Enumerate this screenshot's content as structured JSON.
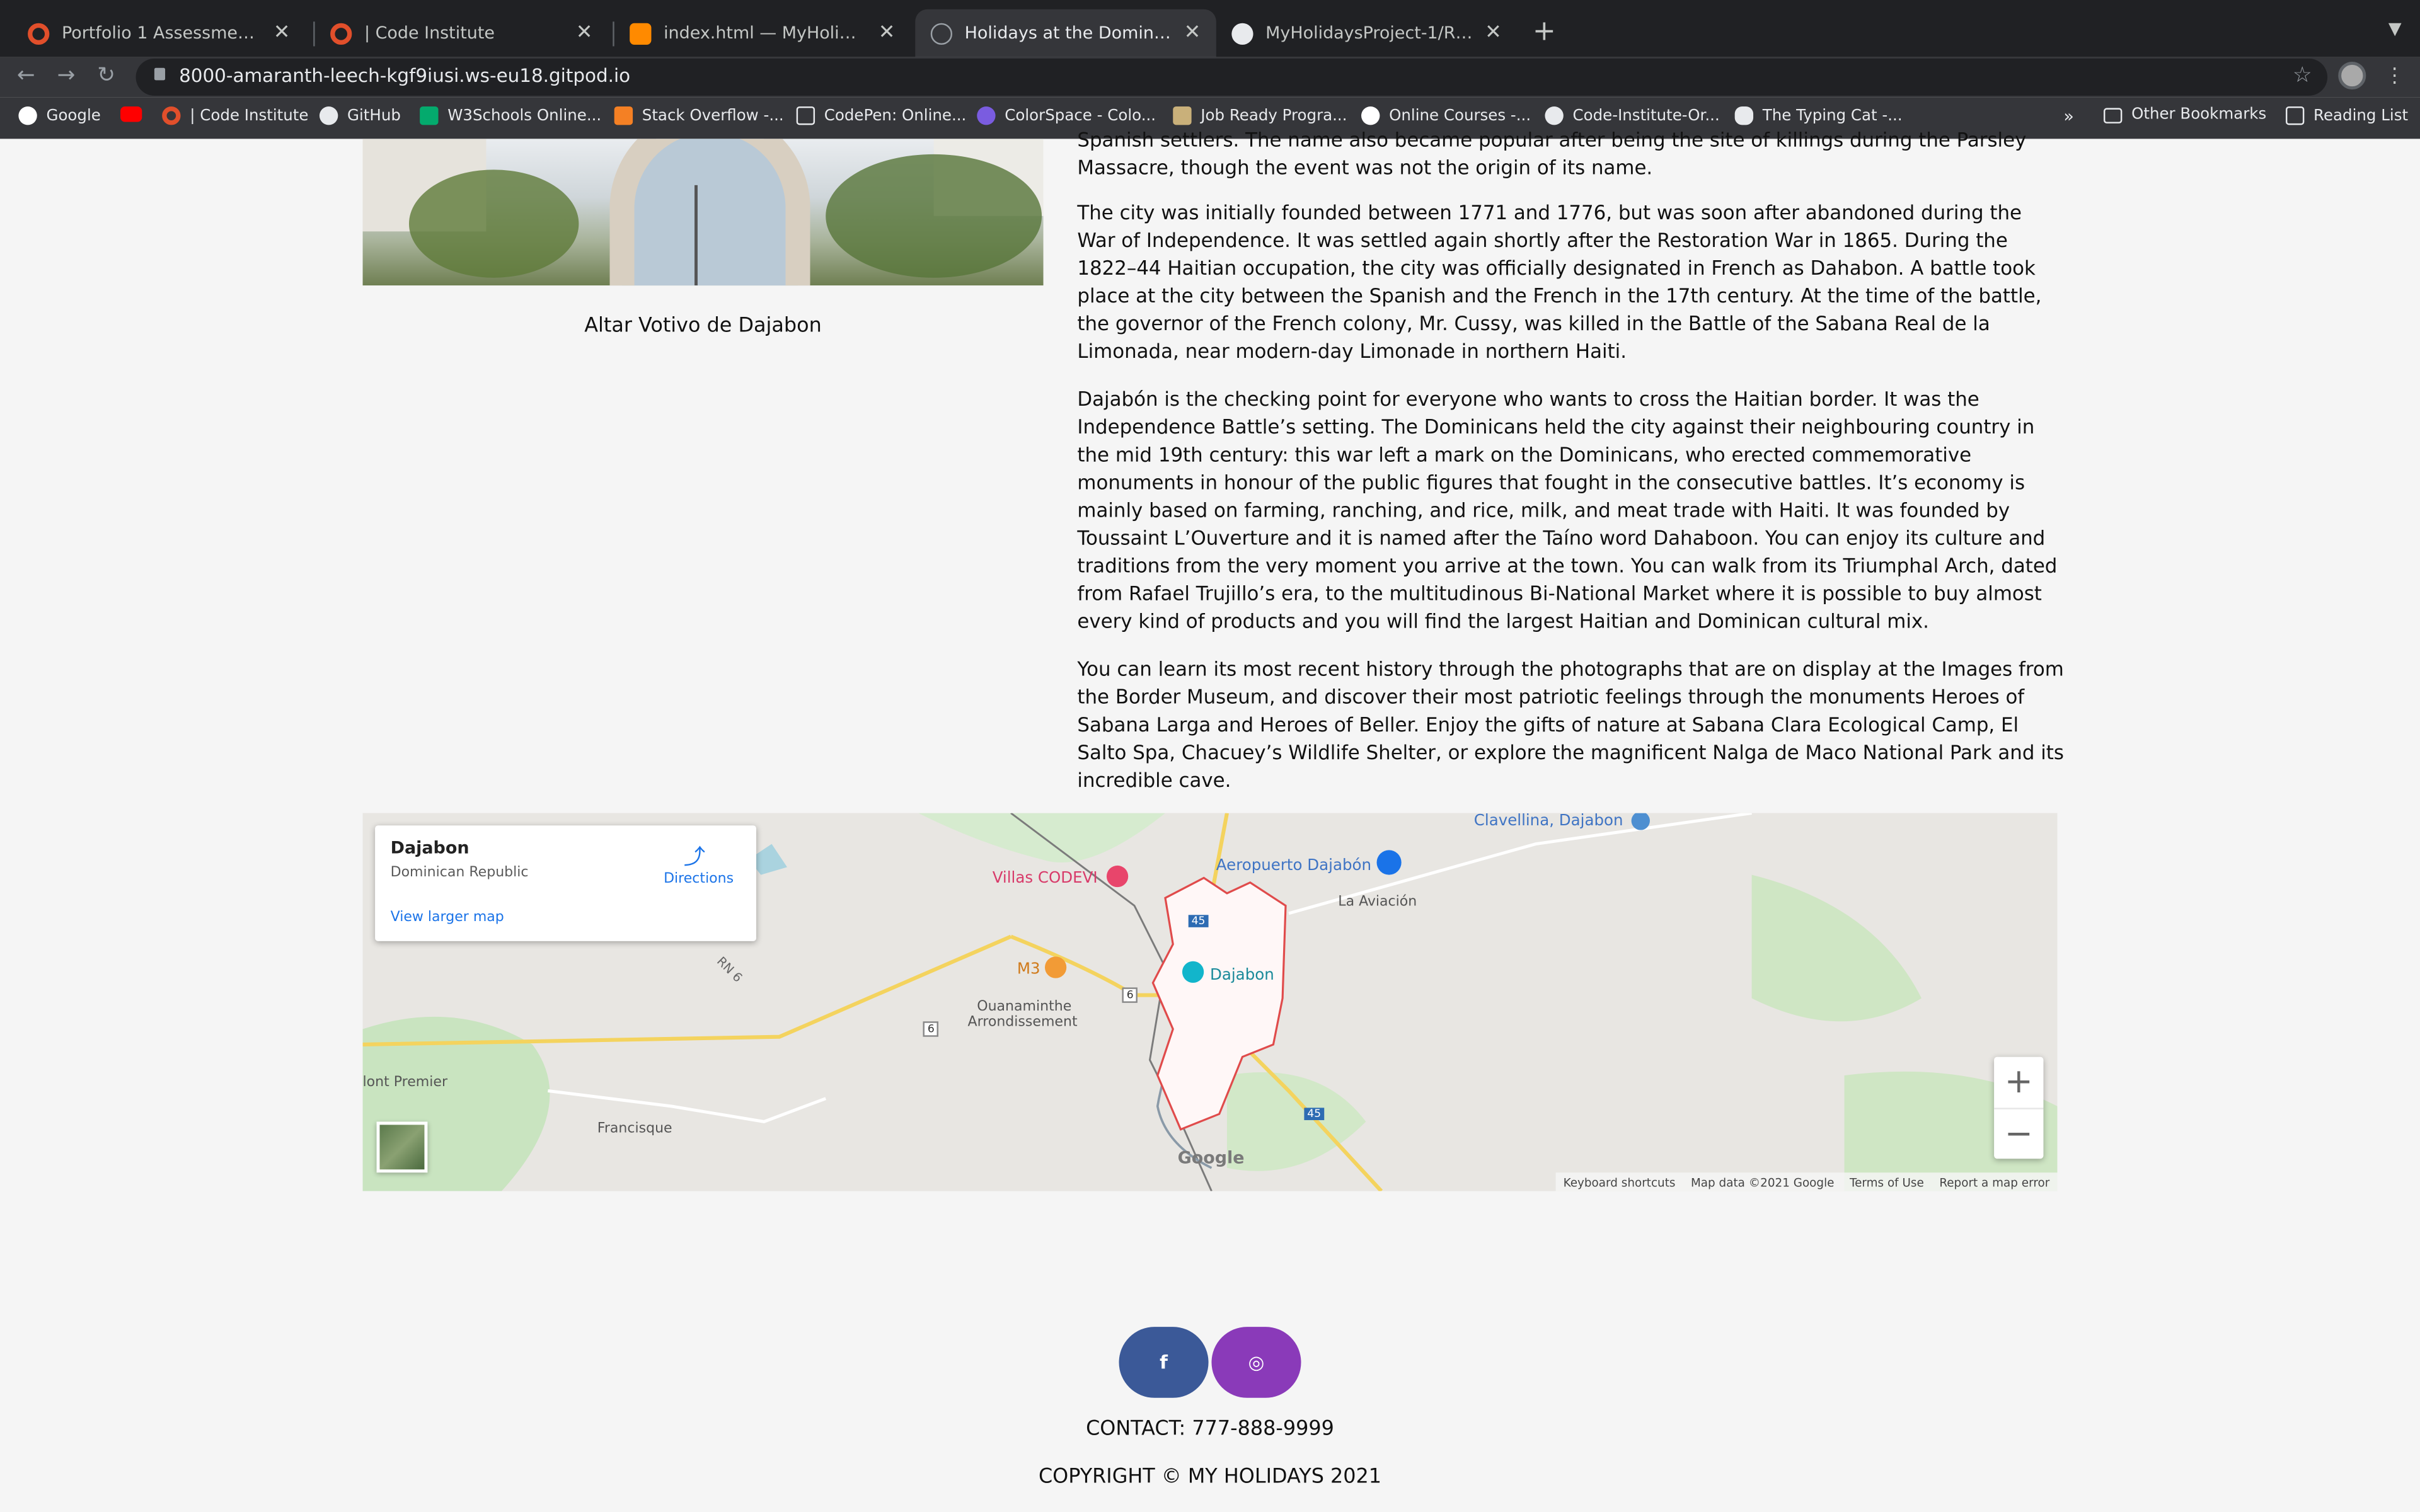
{
  "browser": {
    "tabs": [
      {
        "label": "Portfolio 1 Assessment Guide |",
        "icon": "code-institute-icon",
        "active": false
      },
      {
        "label": "| Code Institute",
        "icon": "code-institute-icon",
        "active": false
      },
      {
        "label": "index.html — MyHolidaysProje",
        "icon": "gitpod-icon",
        "active": false
      },
      {
        "label": "Holidays at the Dominican Rep",
        "icon": "globe-icon",
        "active": true
      },
      {
        "label": "MyHolidaysProject-1/README",
        "icon": "github-icon",
        "active": false
      }
    ],
    "close_glyph": "✕",
    "new_tab_glyph": "+",
    "url": "8000-amaranth-leech-kgf9iusi.ws-eu18.gitpod.io",
    "bookmarks": [
      {
        "label": "Google",
        "icon": "google-icon"
      },
      {
        "label": "",
        "icon": "youtube-icon"
      },
      {
        "label": "| Code Institute",
        "icon": "code-institute-icon"
      },
      {
        "label": "GitHub",
        "icon": "github-icon"
      },
      {
        "label": "W3Schools Online...",
        "icon": "w3schools-icon"
      },
      {
        "label": "Stack Overflow -...",
        "icon": "stackoverflow-icon"
      },
      {
        "label": "CodePen: Online...",
        "icon": "codepen-icon"
      },
      {
        "label": "ColorSpace - Colo...",
        "icon": "colorspace-icon"
      },
      {
        "label": "Job Ready Progra...",
        "icon": "bookmark-icon"
      },
      {
        "label": "Online Courses -...",
        "icon": "udemy-icon"
      },
      {
        "label": "Code-Institute-Or...",
        "icon": "github-icon"
      },
      {
        "label": "The Typing Cat -...",
        "icon": "paw-icon"
      }
    ],
    "more_bookmarks": "»",
    "other_bookmarks": "Other Bookmarks",
    "reading_list": "Reading List"
  },
  "page": {
    "figure_caption": "Altar Votivo de Dajabon",
    "paragraphs": [
      "Spanish settlers. The name also became popular after being the site of killings during the Parsley Massacre, though the event was not the origin of its name.",
      "The city was initially founded between 1771 and 1776, but was soon after abandoned during the War of Independence. It was settled again shortly after the Restoration War in 1865. During the 1822–44 Haitian occupation, the city was officially designated in French as Dahabon. A battle took place at the city between the Spanish and the French in the 17th century. At the time of the battle, the governor of the French colony, Mr. Cussy, was killed in the Battle of the Sabana Real de la Limonada, near modern-day Limonade in northern Haiti.",
      "Dajabón is the checking point for everyone who wants to cross the Haitian border. It was the Independence Battle’s setting. The Dominicans held the city against their neighbouring country in the mid 19th century: this war left a mark on the Dominicans, who erected commemorative monuments in honour of the public figures that fought in the consecutive battles. It’s economy is mainly based on farming, ranching, and rice, milk, and meat trade with Haiti. It was founded by Toussaint L’Ouverture and it is named after the Taíno word Dahaboon. You can enjoy its culture and traditions from the very moment you arrive at the town. You can walk from its Triumphal Arch, dated from Rafael Trujillo’s era, to the multitudinous Bi-National Market where it is possible to buy almost every kind of products and you will find the largest Haitian and Dominican cultural mix.",
      "You can learn its most recent history through the photographs that are on display at the Images from the Border Museum, and discover their most patriotic feelings through the monuments Heroes of Sabana Larga and Heroes of Beller. Enjoy the gifts of nature at Sabana Clara Ecological Camp, El Salto Spa, Chacuey’s Wildlife Shelter, or explore the magnificent Nalga de Maco National Park and its incredible cave."
    ]
  },
  "map": {
    "place_title": "Dajabon",
    "place_subtitle": "Dominican Republic",
    "directions": "Directions",
    "view_larger": "View larger map",
    "zoom_in": "+",
    "zoom_out": "−",
    "labels": {
      "clavellina": "Clavellina, Dajabon",
      "villas": "Villas CODEVI",
      "airport": "Aeropuerto Dajabón",
      "aviacion": "La Aviación",
      "m3": "M3",
      "dajabon": "Dajabon",
      "ouanaminthe1": "Ouanaminthe",
      "ouanaminthe2": "Arrondissement",
      "montpremier": "lont Premier",
      "francisque": "Francisque",
      "rn6": "RN 6",
      "r6a": "6",
      "r6b": "6",
      "r45a": "45",
      "r45b": "45",
      "google": "Google"
    },
    "attribution": {
      "shortcuts": "Keyboard shortcuts",
      "data": "Map data ©2021 Google",
      "terms": "Terms of Use",
      "report": "Report a map error"
    }
  },
  "footer": {
    "facebook_glyph": "f",
    "instagram_glyph": "◎",
    "contact": "CONTACT: 777-888-9999",
    "copyright": "COPYRIGHT © MY HOLIDAYS 2021"
  },
  "colors": {
    "chrome_dark": "#202124",
    "chrome_mid": "#35363a",
    "facebook": "#3b5998",
    "instagram": "#8a3ab9",
    "link_blue": "#1a73e8",
    "page_bg": "#f5f5f5"
  }
}
